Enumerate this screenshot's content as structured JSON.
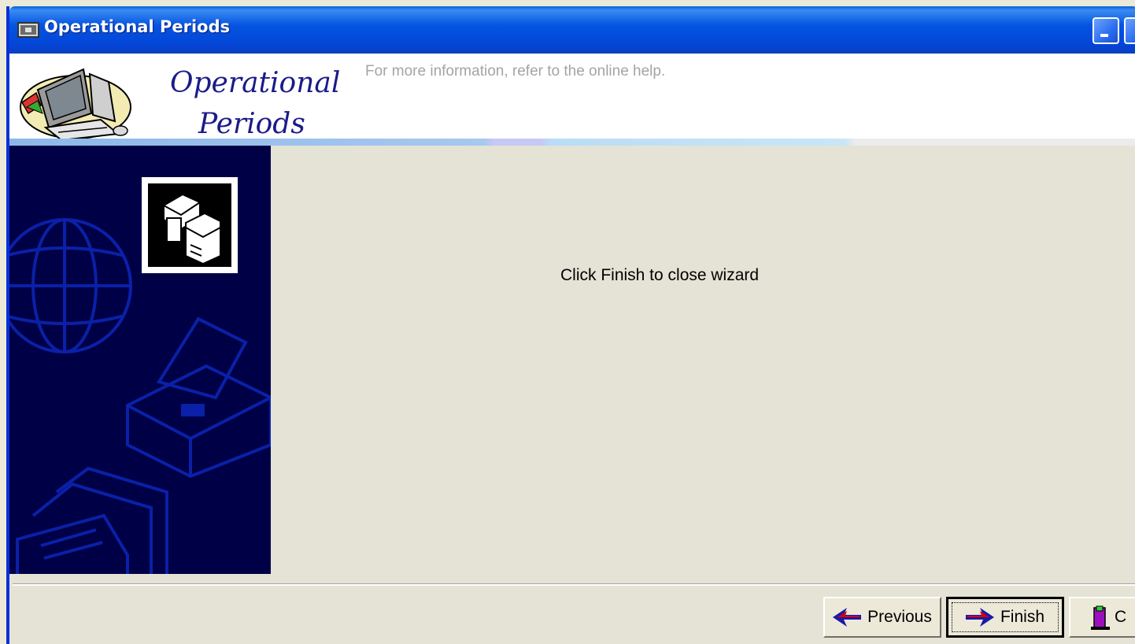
{
  "window": {
    "title": "Operational Periods"
  },
  "header": {
    "title_line1": "Operational",
    "title_line2": "Periods",
    "info": "For more information, refer to the online help."
  },
  "main": {
    "message": "Click Finish to close wizard"
  },
  "buttons": {
    "previous": {
      "label": "Previous",
      "icon": "arrow-left-icon"
    },
    "finish": {
      "label": "Finish",
      "icon": "arrow-right-icon"
    },
    "close": {
      "label": "C",
      "icon": "door-exit-icon"
    }
  },
  "colors": {
    "titlebar": "#0554e2",
    "sidebar": "#000046",
    "body": "#e4e3d5",
    "heading": "#1b1b8a"
  }
}
